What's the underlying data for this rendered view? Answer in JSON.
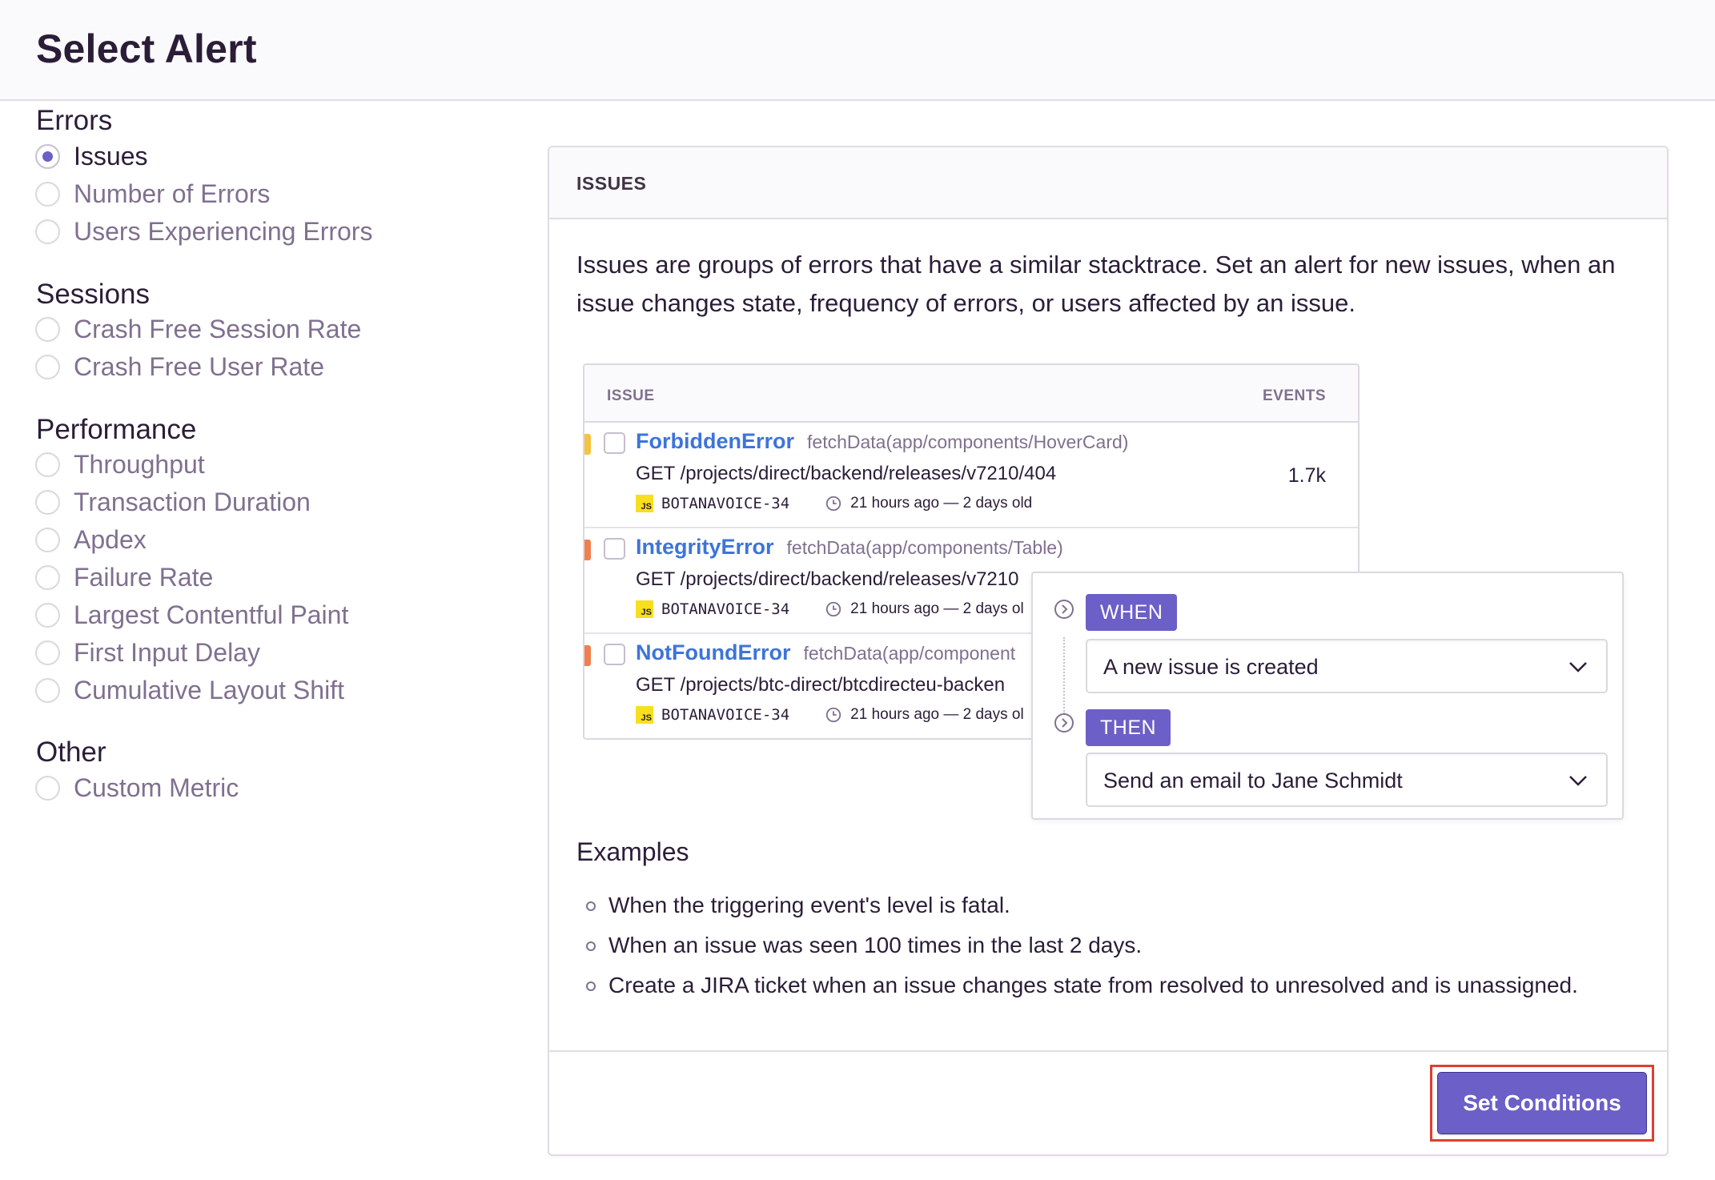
{
  "page": {
    "title": "Select Alert"
  },
  "sidebar": {
    "groups": [
      {
        "title": "Errors",
        "options": [
          "Issues",
          "Number of Errors",
          "Users Experiencing Errors"
        ]
      },
      {
        "title": "Sessions",
        "options": [
          "Crash Free Session Rate",
          "Crash Free User Rate"
        ]
      },
      {
        "title": "Performance",
        "options": [
          "Throughput",
          "Transaction Duration",
          "Apdex",
          "Failure Rate",
          "Largest Contentful Paint",
          "First Input Delay",
          "Cumulative Layout Shift"
        ]
      },
      {
        "title": "Other",
        "options": [
          "Custom Metric"
        ]
      }
    ],
    "selected": "Issues"
  },
  "panel": {
    "header": "ISSUES",
    "description": "Issues are groups of errors that have a similar stacktrace. Set an alert for new issues, when an issue changes state, frequency of errors, or users affected by an issue.",
    "table": {
      "col_issue": "ISSUE",
      "col_events": "EVENTS",
      "rows": [
        {
          "title": "ForbiddenError",
          "culprit": "fetchData(app/components/HoverCard)",
          "message": "GET /projects/direct/backend/releases/v7210/404",
          "short_id": "BOTANAVOICE-34",
          "age": "21 hours ago — 2 days old",
          "events": "1.7k",
          "level_color": "#f5c342"
        },
        {
          "title": "IntegrityError",
          "culprit": "fetchData(app/components/Table)",
          "message": "GET /projects/direct/backend/releases/v7210",
          "short_id": "BOTANAVOICE-34",
          "age": "21 hours ago — 2 days ol",
          "events": "",
          "level_color": "#f0804f"
        },
        {
          "title": "NotFoundError",
          "culprit": "fetchData(app/component",
          "message": "GET /projects/btc-direct/btcdirecteu-backen",
          "short_id": "BOTANAVOICE-34",
          "age": "21 hours ago — 2 days ol",
          "events": "",
          "level_color": "#f0804f"
        }
      ],
      "badge": "JS"
    },
    "builder": {
      "when_label": "WHEN",
      "when_value": "A new issue is created",
      "then_label": "THEN",
      "then_value": "Send an email to Jane Schmidt"
    },
    "examples_title": "Examples",
    "examples": [
      "When the triggering event's level is fatal.",
      "When an issue was seen 100 times in the last 2 days.",
      "Create a JIRA ticket when an issue changes state from resolved to unresolved and is unassigned."
    ],
    "footer": {
      "button_label": "Set Conditions"
    }
  },
  "colors": {
    "accent": "#6c5fc7",
    "link": "#3d74db",
    "highlight_border": "#e03e2f"
  },
  "icons": {
    "clock": "clock-icon",
    "chevron": "chevron-down-icon",
    "step": "chevron-circle-icon"
  }
}
